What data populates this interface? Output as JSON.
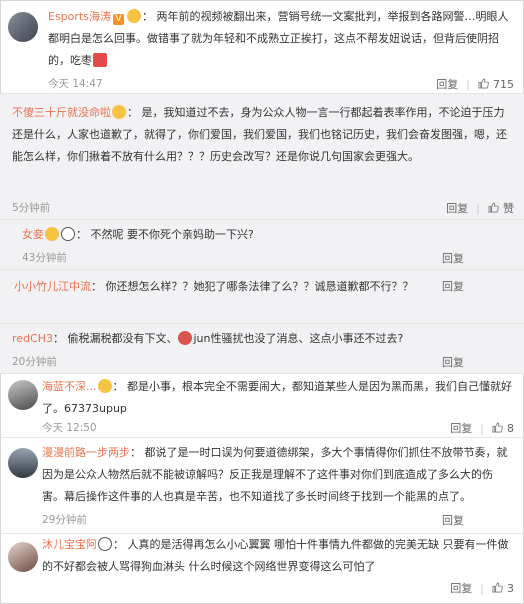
{
  "comments": [
    {
      "name": "Esports海涛",
      "text": "两年前的视频被翻出来，营销号统一文案批判，举报到各路网警…明眼人都明白是怎么回事。做错事了就为年轻和不成熟立正挨打，这点不帮发妞说话，但背后使阴招的，吃枣",
      "time": "今天 14:47",
      "reply": "回复",
      "likes": "715",
      "verified": "V"
    },
    {
      "name": "不傻三十斤就没命啦",
      "text": "是，我知道过不去，身为公众人物一言一行都起着表率作用，不论迫于压力还是什么，人家也道歉了，就得了，你们爱国，我们爱国，我们也铭记历史，我们会奋发图强，嗯，还能怎么样，你们揪着不放有什么用？？？历史会改写？还是你说几句国家会更强大。",
      "time": "5分钟前",
      "reply": "回复",
      "likes": "赞"
    },
    {
      "name": "女妾",
      "text": "不然呢 要不你死个亲妈助一下兴?",
      "time": "43分钟前",
      "reply": "回复"
    },
    {
      "name": "小小竹儿江中流",
      "text": "你还想怎么样？？她犯了哪条法律了么？？诚恳道歉都不行？？",
      "time": "",
      "reply": "回复"
    },
    {
      "name": "redCH3",
      "text": "偷税漏税都没有下文、",
      "text2": "jun性骚扰也没了消息、这点小事还不过去?",
      "time": "20分钟前",
      "reply": "回复"
    },
    {
      "name": "海蓝不深...",
      "text": "都是小事，根本完全不需要闹大，都知道某些人是因为黑而黑，我们自己懂就好了。67373upup",
      "time": "今天 12:50",
      "reply": "回复",
      "likes": "8"
    },
    {
      "name": "漫漫前路一步两步",
      "text": "都说了是一时口误为何要道德绑架，多大个事情得你们抓住不放带节奏，就因为是公众人物然后就不能被谅解吗？反正我是理解不了这件事对你们到底造成了多么大的伤害。幕后操作这件事的人也真是辛苦，也不知道找了多长时间终于找到一个能黑的点了。",
      "time": "29分钟前",
      "reply": "回复"
    },
    {
      "name": "沐儿宝宝阿",
      "text": "人真的是活得再怎么小心翼翼 哪怕十件事情九件都做的完美无缺 只要有一件做的不好都会被人骂得狗血淋头 什么时候这个网络世界变得这么可怕了",
      "time": "",
      "reply": "回复",
      "likes": "3"
    }
  ],
  "colors": {
    "name": "#eb7350",
    "sub_bg": "#f2f2f5",
    "time": "#999999"
  },
  "icons": [
    "verified-badge-icon",
    "emoji-icon",
    "thumb-up-icon"
  ]
}
